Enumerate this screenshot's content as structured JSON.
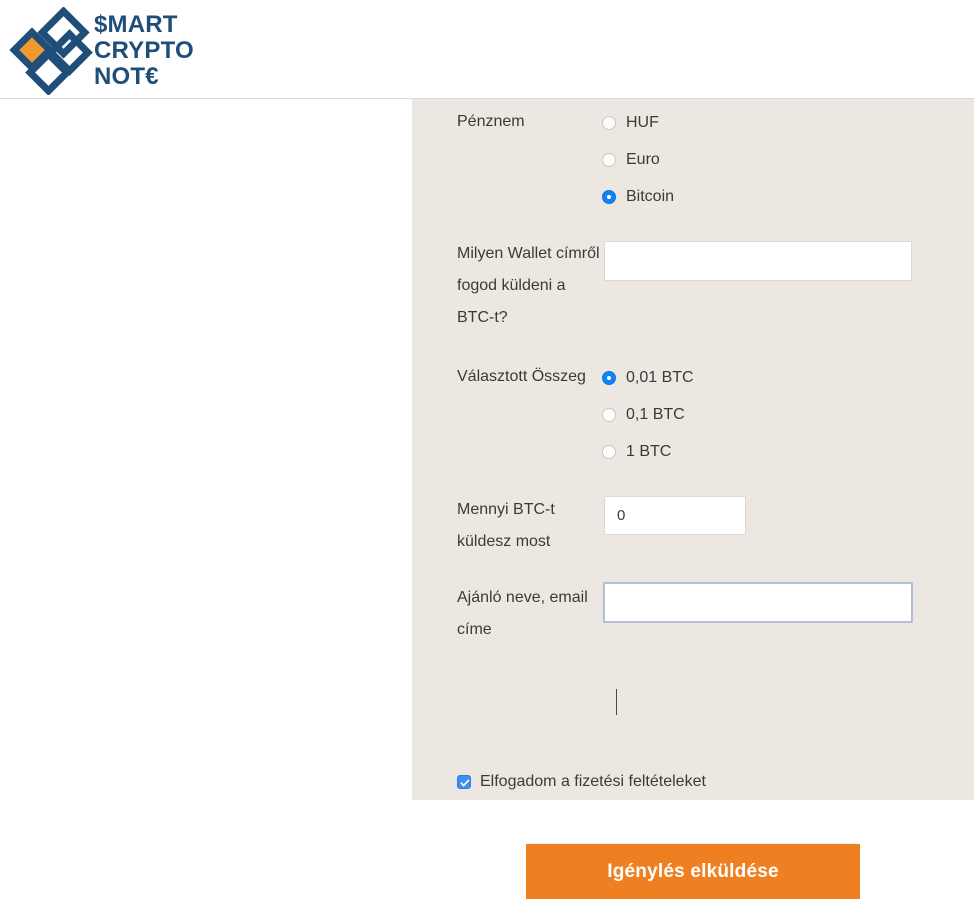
{
  "header": {
    "logo": {
      "line1": "$MART",
      "line2": "CRYPTO",
      "line3": "NOT€",
      "mark_name": "four-diamonds-logo-mark",
      "colors": {
        "navy": "#1f4e79",
        "orange": "#f0992e"
      }
    }
  },
  "form": {
    "currency": {
      "label": "Pénznem",
      "options": [
        {
          "label": "HUF",
          "selected": false
        },
        {
          "label": "Euro",
          "selected": false
        },
        {
          "label": "Bitcoin",
          "selected": true
        }
      ]
    },
    "wallet": {
      "label": "Milyen Wallet címről fogod küldeni a BTC-t?",
      "value": "",
      "placeholder": ""
    },
    "amount_choice": {
      "label": "Választott Összeg",
      "options": [
        {
          "label": "0,01 BTC",
          "selected": true
        },
        {
          "label": "0,1 BTC",
          "selected": false
        },
        {
          "label": "1 BTC",
          "selected": false
        }
      ]
    },
    "send_amount": {
      "label": "Mennyi BTC-t küldesz most",
      "value": "0",
      "placeholder": ""
    },
    "referrer": {
      "label": "Ajánló neve, email címe",
      "value": "",
      "placeholder": "",
      "focused": true
    },
    "terms": {
      "label": "Elfogadom a fizetési feltételeket",
      "checked": true
    },
    "submit": {
      "label": "Igénylés elküldése",
      "color": "#ef8022"
    }
  }
}
